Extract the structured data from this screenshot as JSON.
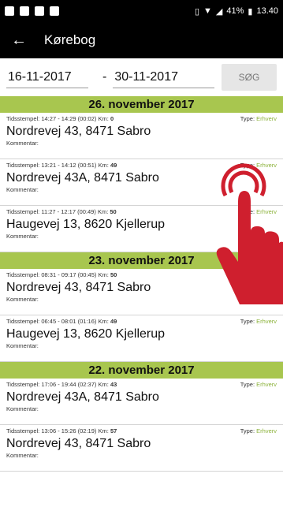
{
  "status": {
    "battery": "41%",
    "time": "13.40"
  },
  "app": {
    "title": "Kørebog"
  },
  "filter": {
    "from": "16-11-2017",
    "dash": "-",
    "to": "30-11-2017",
    "search_label": "SØG"
  },
  "labels": {
    "timestamp": "Tidsstempel:",
    "km": "Km:",
    "type": "Type:",
    "comment": "Kommentar:"
  },
  "days": [
    {
      "date": "26. november 2017",
      "entries": [
        {
          "time": "14:27 - 14:29 (00:02)",
          "km": "0",
          "type": "Erhverv",
          "address": "Nordrevej 43, 8471 Sabro"
        },
        {
          "time": "13:21 - 14:12 (00:51)",
          "km": "49",
          "type": "Erhverv",
          "address": "Nordrevej 43A, 8471 Sabro"
        },
        {
          "time": "11:27 - 12:17 (00:49)",
          "km": "50",
          "type": "Erhverv",
          "address": "Haugevej 13, 8620 Kjellerup"
        }
      ]
    },
    {
      "date": "23. november 2017",
      "entries": [
        {
          "time": "08:31 - 09:17 (00:45)",
          "km": "50",
          "type": "Erhverv",
          "address": "Nordrevej 43, 8471 Sabro"
        },
        {
          "time": "06:45 - 08:01 (01:16)",
          "km": "49",
          "type": "Erhverv",
          "address": "Haugevej 13, 8620 Kjellerup"
        }
      ]
    },
    {
      "date": "22. november 2017",
      "entries": [
        {
          "time": "17:06 - 19:44 (02:37)",
          "km": "43",
          "type": "Erhverv",
          "address": "Nordrevej 43A, 8471 Sabro"
        },
        {
          "time": "13:06 - 15:26 (02:19)",
          "km": "57",
          "type": "Erhverv",
          "address": "Nordrevej 43, 8471 Sabro"
        }
      ]
    }
  ],
  "colors": {
    "accent": "#a8c64f",
    "type_text": "#8bb23a",
    "hand": "#cf1f2e"
  }
}
